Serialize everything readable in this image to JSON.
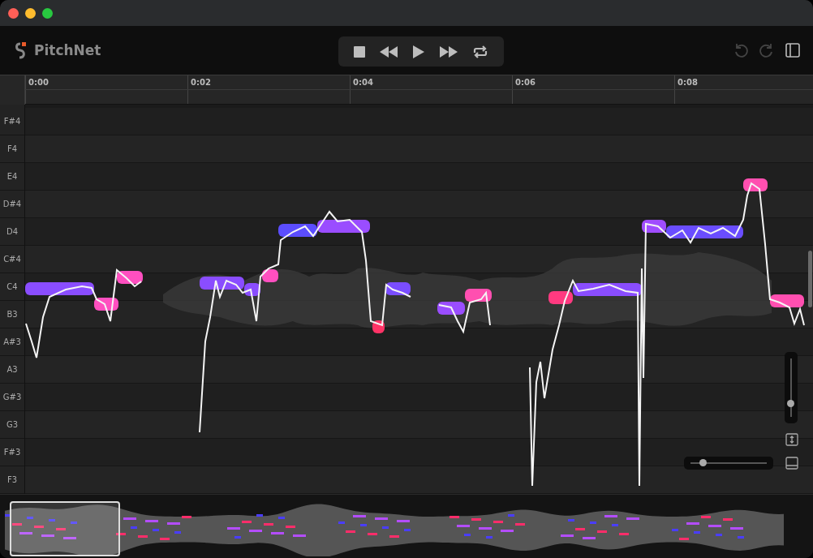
{
  "app": {
    "name": "PitchNet"
  },
  "timeline": {
    "ticks": [
      "0:00",
      "0:02",
      "0:04",
      "0:06",
      "0:08"
    ]
  },
  "piano_keys": [
    "F#4",
    "F4",
    "E4",
    "D#4",
    "D4",
    "C#4",
    "C4",
    "B3",
    "A#3",
    "A3",
    "G#3",
    "G3",
    "F#3",
    "F3"
  ],
  "zoom": {
    "vertical": {
      "level": 0.24
    },
    "horizontal": {
      "level": 0.16
    }
  }
}
